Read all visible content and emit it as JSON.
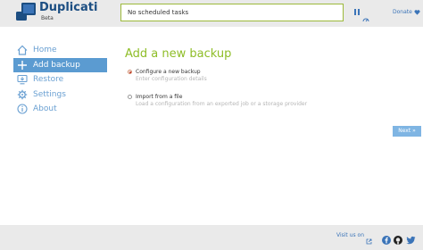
{
  "header": {
    "app_name": "Duplicati",
    "app_subtitle": "Beta",
    "status_text": "No scheduled tasks",
    "donate_label": "Donate",
    "donate_icon": "heart-icon"
  },
  "sidebar": {
    "items": [
      {
        "label": "Home",
        "icon": "home-icon"
      },
      {
        "label": "Add backup",
        "icon": "plus-icon"
      },
      {
        "label": "Restore",
        "icon": "restore-icon"
      },
      {
        "label": "Settings",
        "icon": "gear-icon"
      },
      {
        "label": "About",
        "icon": "info-icon"
      }
    ]
  },
  "main": {
    "title": "Add a new backup",
    "options": [
      {
        "label": "Configure a new backup",
        "description": "Enter configuration details",
        "selected": true
      },
      {
        "label": "Import from a file",
        "description": "Load a configuration from an exported job or a storage provider",
        "selected": false
      }
    ],
    "next_label": "Next »"
  },
  "footer": {
    "visit_label": "Visit us on",
    "social": [
      "facebook-icon",
      "github-icon",
      "twitter-icon"
    ]
  },
  "colors": {
    "brand_blue": "#1c4e82",
    "accent_green": "#8ebd27",
    "nav_active": "#5b9bd1",
    "next_button": "#7fb5e3"
  }
}
